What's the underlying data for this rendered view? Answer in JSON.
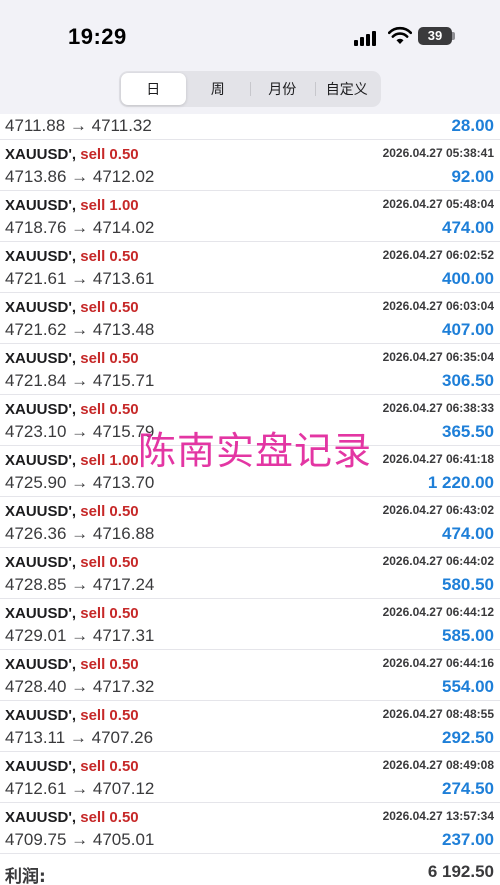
{
  "status": {
    "time": "19:29",
    "battery": "39"
  },
  "tabs": [
    {
      "label": "日",
      "active": true
    },
    {
      "label": "周",
      "active": false
    },
    {
      "label": "月份",
      "active": false
    },
    {
      "label": "自定义",
      "active": false
    }
  ],
  "first_row": {
    "prices": "4711.88 → 4711.32",
    "profit": "28.00"
  },
  "rows": [
    {
      "symbol": "XAUUSD',",
      "side": "sell 0.50",
      "time": "2026.04.27 05:38:41",
      "prices": "4713.86 → 4712.02",
      "profit": "92.00"
    },
    {
      "symbol": "XAUUSD',",
      "side": "sell 1.00",
      "time": "2026.04.27 05:48:04",
      "prices": "4718.76 → 4714.02",
      "profit": "474.00"
    },
    {
      "symbol": "XAUUSD',",
      "side": "sell 0.50",
      "time": "2026.04.27 06:02:52",
      "prices": "4721.61 → 4713.61",
      "profit": "400.00"
    },
    {
      "symbol": "XAUUSD',",
      "side": "sell 0.50",
      "time": "2026.04.27 06:03:04",
      "prices": "4721.62 → 4713.48",
      "profit": "407.00"
    },
    {
      "symbol": "XAUUSD',",
      "side": "sell 0.50",
      "time": "2026.04.27 06:35:04",
      "prices": "4721.84 → 4715.71",
      "profit": "306.50"
    },
    {
      "symbol": "XAUUSD',",
      "side": "sell 0.50",
      "time": "2026.04.27 06:38:33",
      "prices": "4723.10 → 4715.79",
      "profit": "365.50"
    },
    {
      "symbol": "XAUUSD',",
      "side": "sell 1.00",
      "time": "2026.04.27 06:41:18",
      "prices": "4725.90 → 4713.70",
      "profit": "1 220.00"
    },
    {
      "symbol": "XAUUSD',",
      "side": "sell 0.50",
      "time": "2026.04.27 06:43:02",
      "prices": "4726.36 → 4716.88",
      "profit": "474.00"
    },
    {
      "symbol": "XAUUSD',",
      "side": "sell 0.50",
      "time": "2026.04.27 06:44:02",
      "prices": "4728.85 → 4717.24",
      "profit": "580.50"
    },
    {
      "symbol": "XAUUSD',",
      "side": "sell 0.50",
      "time": "2026.04.27 06:44:12",
      "prices": "4729.01 → 4717.31",
      "profit": "585.00"
    },
    {
      "symbol": "XAUUSD',",
      "side": "sell 0.50",
      "time": "2026.04.27 06:44:16",
      "prices": "4728.40 → 4717.32",
      "profit": "554.00"
    },
    {
      "symbol": "XAUUSD',",
      "side": "sell 0.50",
      "time": "2026.04.27 08:48:55",
      "prices": "4713.11 → 4707.26",
      "profit": "292.50"
    },
    {
      "symbol": "XAUUSD',",
      "side": "sell 0.50",
      "time": "2026.04.27 08:49:08",
      "prices": "4712.61 → 4707.12",
      "profit": "274.50"
    },
    {
      "symbol": "XAUUSD',",
      "side": "sell 0.50",
      "time": "2026.04.27 13:57:34",
      "prices": "4709.75 → 4705.01",
      "profit": "237.00"
    }
  ],
  "summary": {
    "label": "利润:",
    "value": "6 192.50"
  },
  "watermark": "陈南实盘记录",
  "colors": {
    "profit": "#1e7fd8",
    "sell": "#c62828",
    "watermark": "#e0219a"
  }
}
